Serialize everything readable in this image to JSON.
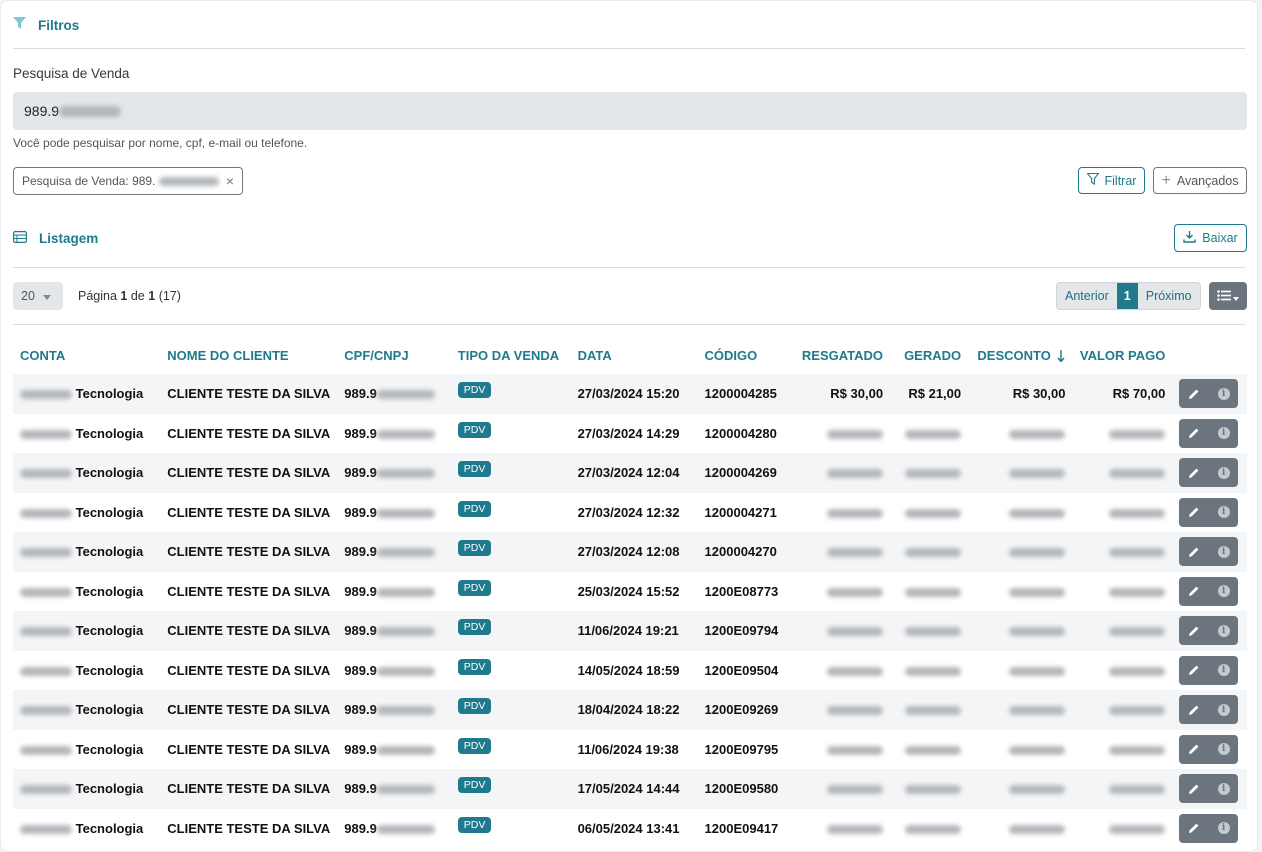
{
  "filters": {
    "title": "Filtros",
    "search_label": "Pesquisa de Venda",
    "search_value": "989.9",
    "help_text": "Você pode pesquisar por nome, cpf, e-mail ou telefone.",
    "chip_label": "Pesquisa de Venda: 989.",
    "chip_close": "×",
    "filter_button": "Filtrar",
    "advanced_button": "Avançados"
  },
  "listing": {
    "title": "Listagem",
    "download_button": "Baixar",
    "page_size": "20",
    "page_prefix": "Página",
    "page_current": "1",
    "page_of": "de",
    "page_total": "1",
    "total_count": "(17)",
    "prev_label": "Anterior",
    "active_page": "1",
    "next_label": "Próximo"
  },
  "table": {
    "headers": {
      "conta": "CONTA",
      "nome": "NOME DO CLIENTE",
      "cpf": "CPF/CNPJ",
      "tipo": "TIPO DA VENDA",
      "data": "DATA",
      "codigo": "CÓDIGO",
      "resgatado": "RESGATADO",
      "gerado": "GERADO",
      "desconto": "DESCONTO",
      "valor": "VALOR PAGO"
    },
    "rows": [
      {
        "conta": "Tecnologia",
        "nome": "CLIENTE TESTE DA SILVA",
        "cpf": "989.9",
        "tipo": "PDV",
        "data": "27/03/2024 15:20",
        "codigo": "1200004285",
        "resgatado": "R$ 30,00",
        "gerado": "R$ 21,00",
        "desconto": "R$ 30,00",
        "valor": "R$ 70,00"
      },
      {
        "conta": "Tecnologia",
        "nome": "CLIENTE TESTE DA SILVA",
        "cpf": "989.9",
        "tipo": "PDV",
        "data": "27/03/2024 14:29",
        "codigo": "1200004280"
      },
      {
        "conta": "Tecnologia",
        "nome": "CLIENTE TESTE DA SILVA",
        "cpf": "989.9",
        "tipo": "PDV",
        "data": "27/03/2024 12:04",
        "codigo": "1200004269"
      },
      {
        "conta": "Tecnologia",
        "nome": "CLIENTE TESTE DA SILVA",
        "cpf": "989.9",
        "tipo": "PDV",
        "data": "27/03/2024 12:32",
        "codigo": "1200004271"
      },
      {
        "conta": "Tecnologia",
        "nome": "CLIENTE TESTE DA SILVA",
        "cpf": "989.9",
        "tipo": "PDV",
        "data": "27/03/2024 12:08",
        "codigo": "1200004270"
      },
      {
        "conta": "Tecnologia",
        "nome": "CLIENTE TESTE DA SILVA",
        "cpf": "989.9",
        "tipo": "PDV",
        "data": "25/03/2024 15:52",
        "codigo": "1200E08773"
      },
      {
        "conta": "Tecnologia",
        "nome": "CLIENTE TESTE DA SILVA",
        "cpf": "989.9",
        "tipo": "PDV",
        "data": "11/06/2024 19:21",
        "codigo": "1200E09794"
      },
      {
        "conta": "Tecnologia",
        "nome": "CLIENTE TESTE DA SILVA",
        "cpf": "989.9",
        "tipo": "PDV",
        "data": "14/05/2024 18:59",
        "codigo": "1200E09504"
      },
      {
        "conta": "Tecnologia",
        "nome": "CLIENTE TESTE DA SILVA",
        "cpf": "989.9",
        "tipo": "PDV",
        "data": "18/04/2024 18:22",
        "codigo": "1200E09269"
      },
      {
        "conta": "Tecnologia",
        "nome": "CLIENTE TESTE DA SILVA",
        "cpf": "989.9",
        "tipo": "PDV",
        "data": "11/06/2024 19:38",
        "codigo": "1200E09795"
      },
      {
        "conta": "Tecnologia",
        "nome": "CLIENTE TESTE DA SILVA",
        "cpf": "989.9",
        "tipo": "PDV",
        "data": "17/05/2024 14:44",
        "codigo": "1200E09580"
      },
      {
        "conta": "Tecnologia",
        "nome": "CLIENTE TESTE DA SILVA",
        "cpf": "989.9",
        "tipo": "PDV",
        "data": "06/05/2024 13:41",
        "codigo": "1200E09417"
      }
    ]
  },
  "icons": {
    "filter": "filter-icon",
    "plus": "plus-icon",
    "list": "table-list-icon",
    "download": "download-icon",
    "sort": "sort-arrow-icon",
    "edit": "pencil-icon",
    "info": "info-icon",
    "caret": "caret-down-icon"
  },
  "colors": {
    "accent": "#1e7a8c",
    "action_gray": "#6c757d",
    "input_bg": "#e4e7ea"
  }
}
